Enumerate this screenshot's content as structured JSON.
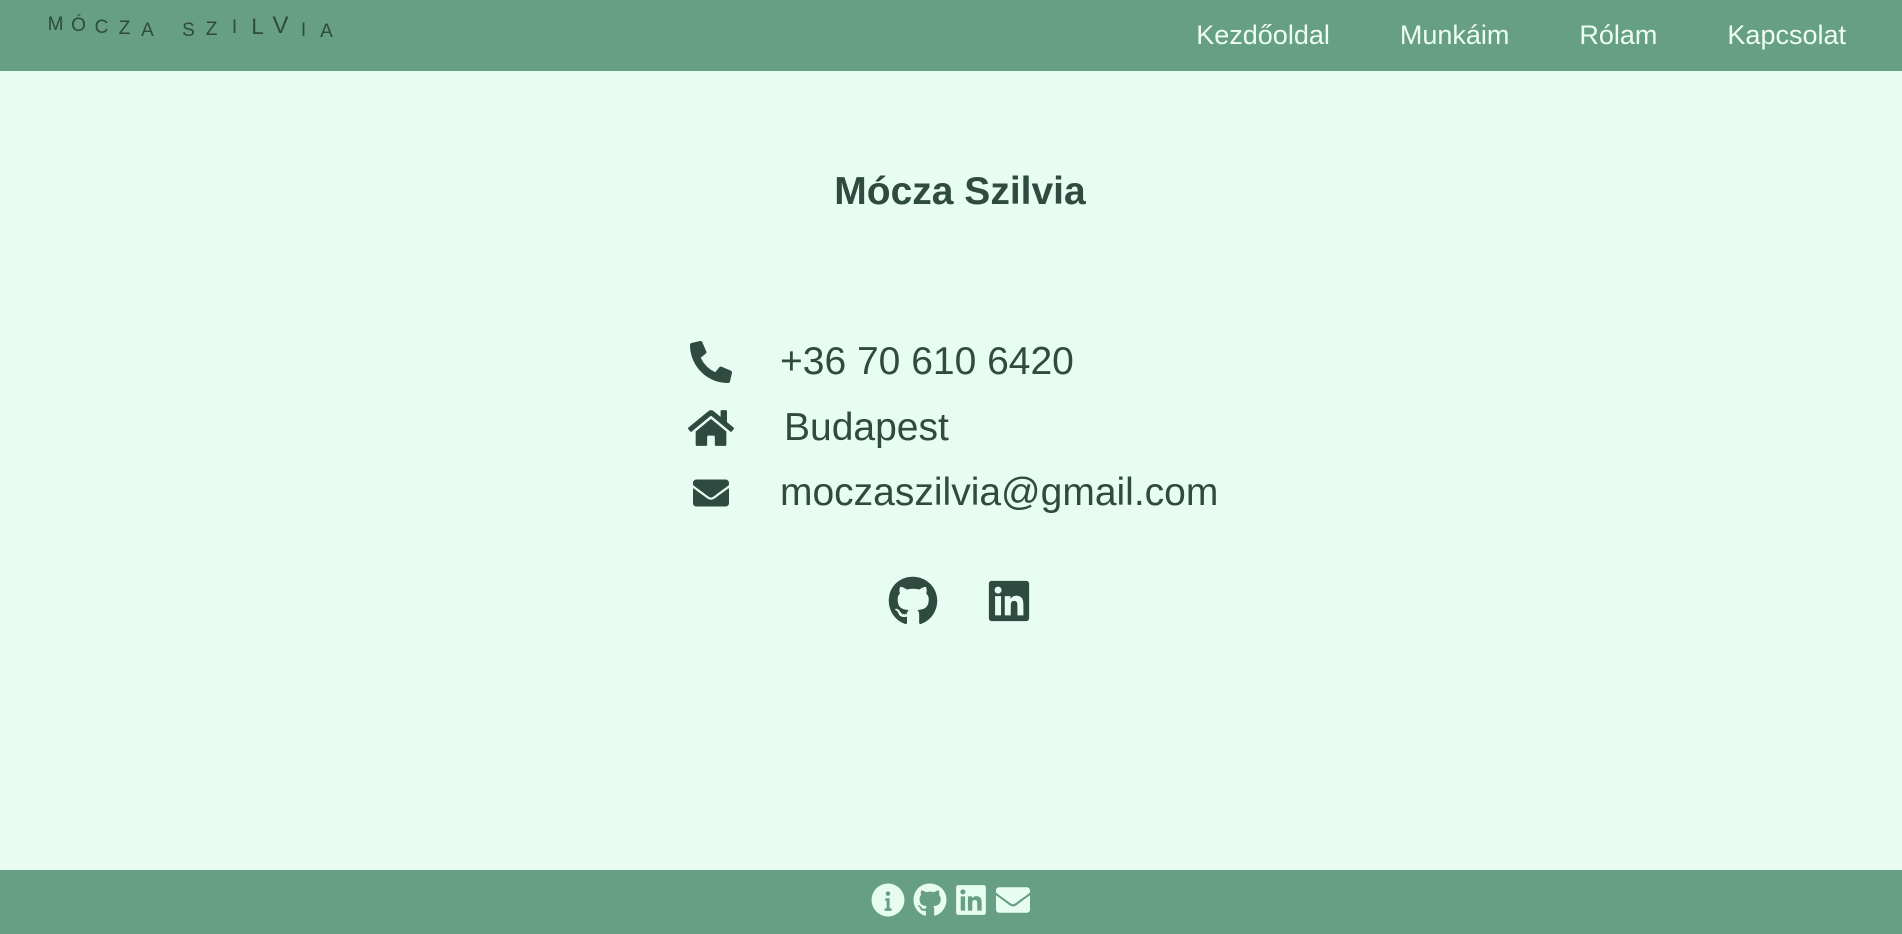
{
  "header": {
    "logo_letters": [
      "M",
      "Ó",
      "C",
      "Z",
      "A",
      " ",
      "S",
      "Z",
      "I",
      "L",
      "V",
      "I",
      "A"
    ],
    "nav": [
      {
        "label": "Kezdőoldal"
      },
      {
        "label": "Munkáim"
      },
      {
        "label": "Rólam"
      },
      {
        "label": "Kapcsolat"
      }
    ]
  },
  "main": {
    "title": "Mócza Szilvia",
    "contacts": [
      {
        "icon": "phone-icon",
        "text": "+36 70 610 6420"
      },
      {
        "icon": "home-icon",
        "text": "Budapest"
      },
      {
        "icon": "envelope-icon",
        "text": "moczaszilvia@gmail.com"
      }
    ],
    "social": [
      {
        "icon": "github-icon"
      },
      {
        "icon": "linkedin-icon"
      }
    ]
  },
  "footer": {
    "icons": [
      "info-icon",
      "github-icon",
      "linkedin-icon",
      "envelope-icon"
    ]
  },
  "colors": {
    "bar": "#669f83",
    "background": "#e8fdf1",
    "text_dark": "#2f4a40",
    "text_light": "#edfdf4"
  }
}
